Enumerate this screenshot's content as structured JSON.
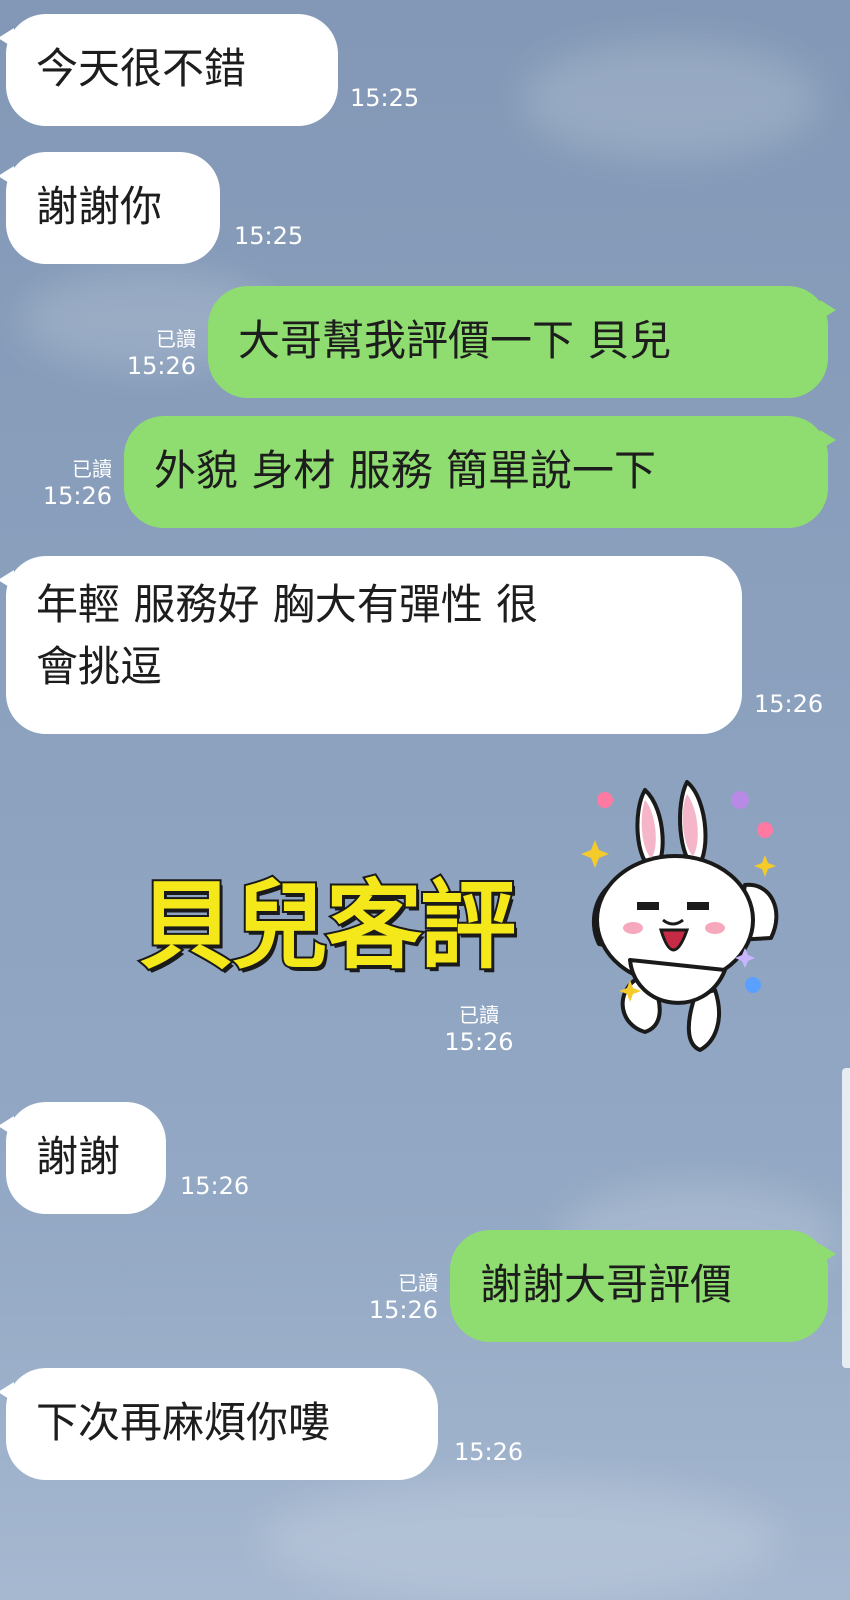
{
  "messages": [
    {
      "side": "in",
      "text": "今天很不錯",
      "time": "15:25"
    },
    {
      "side": "in",
      "text": "謝謝你",
      "time": "15:25"
    },
    {
      "side": "out",
      "text": "大哥幫我評價一下 貝兒",
      "time": "15:26",
      "read": "已讀"
    },
    {
      "side": "out",
      "text": "外貌 身材 服務 簡單說一下",
      "time": "15:26",
      "read": "已讀"
    },
    {
      "side": "in",
      "text_line1": "年輕 服務好 胸大有彈性 很",
      "text_line2": "會挑逗",
      "time": "15:26"
    },
    {
      "side": "in",
      "text": "謝謝",
      "time": "15:26"
    },
    {
      "side": "out",
      "text": "謝謝大哥評價",
      "time": "15:26",
      "read": "已讀"
    },
    {
      "side": "in",
      "text": "下次再麻煩你嘍",
      "time": "15:26"
    }
  ],
  "sticker": {
    "text": "貝兒客評",
    "time": "15:26",
    "read": "已讀",
    "icon": "bunny-sticker-icon"
  },
  "colors": {
    "incoming": "#ffffff",
    "outgoing": "#8fdd70",
    "background": "#8aa0bd",
    "sticker_text": "#f5e81a"
  }
}
